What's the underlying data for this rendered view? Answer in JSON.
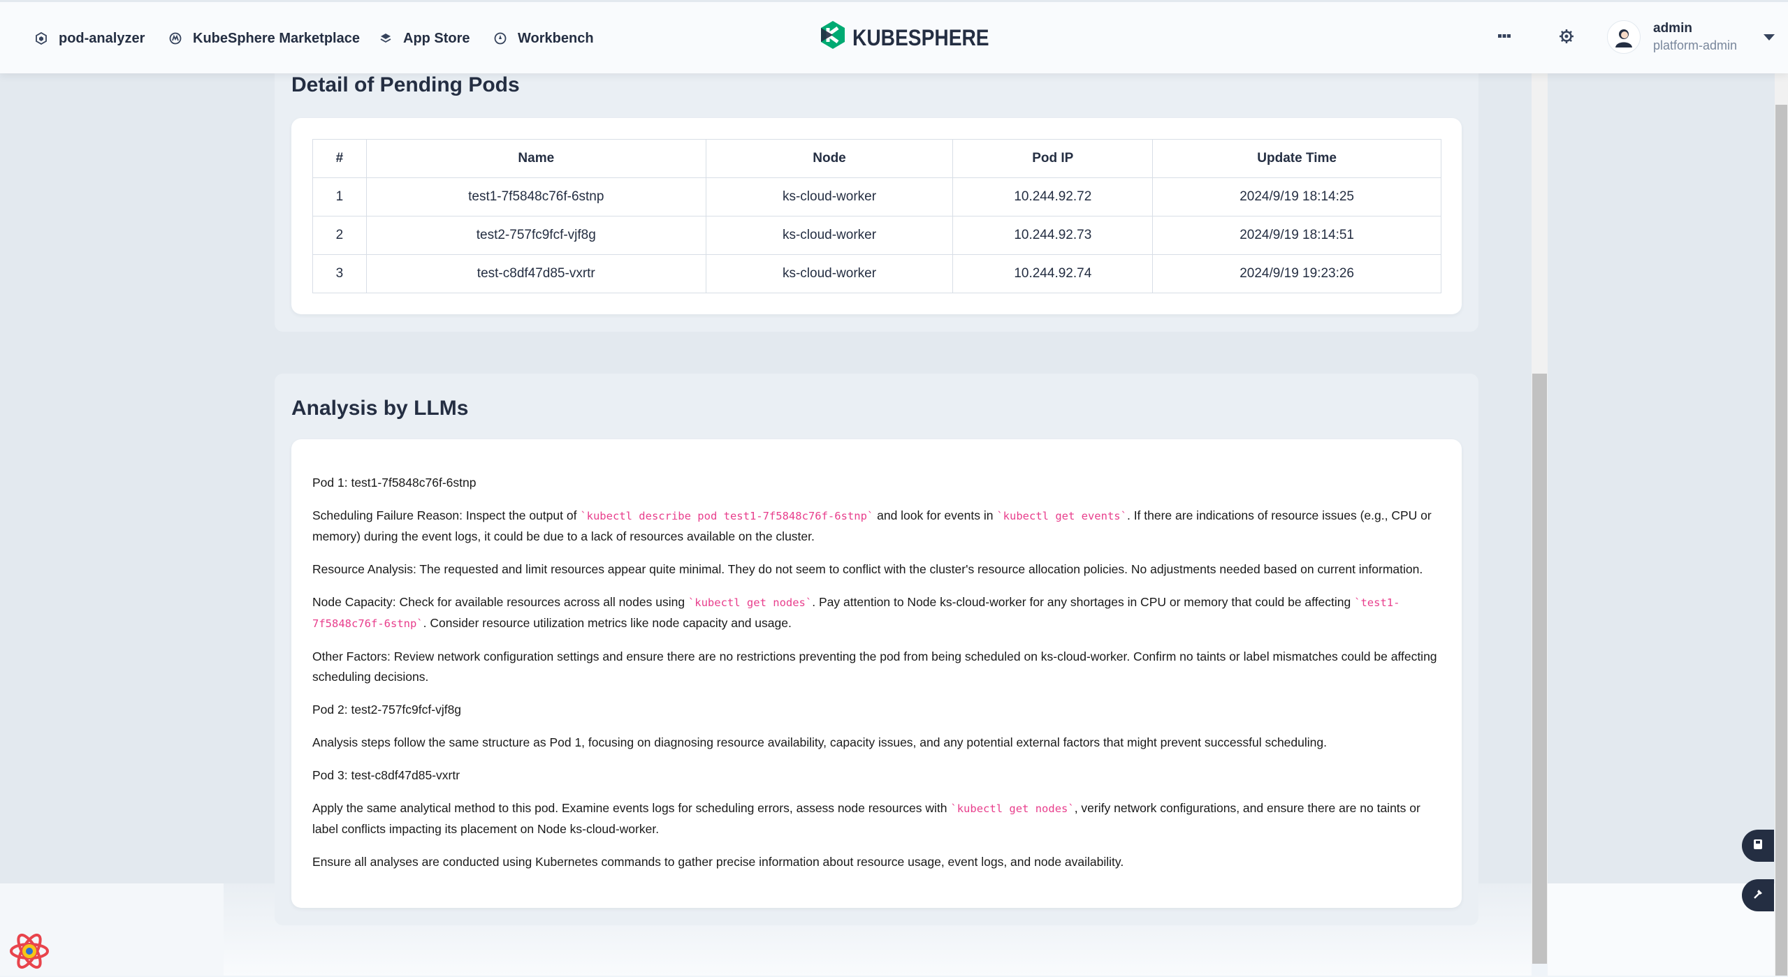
{
  "nav": {
    "items": [
      {
        "label": "pod-analyzer",
        "icon": "cube-icon"
      },
      {
        "label": "KubeSphere Marketplace",
        "icon": "marketplace-icon"
      },
      {
        "label": "App Store",
        "icon": "stack-icon"
      },
      {
        "label": "Workbench",
        "icon": "compass-icon"
      }
    ],
    "logo_text": "KUBESPHERE",
    "user": {
      "name": "admin",
      "role": "platform-admin"
    }
  },
  "pending": {
    "title": "Detail of Pending Pods",
    "columns": [
      "#",
      "Name",
      "Node",
      "Pod IP",
      "Update Time"
    ],
    "rows": [
      [
        "1",
        "test1-7f5848c76f-6stnp",
        "ks-cloud-worker",
        "10.244.92.72",
        "2024/9/19 18:14:25"
      ],
      [
        "2",
        "test2-757fc9fcf-vjf8g",
        "ks-cloud-worker",
        "10.244.92.73",
        "2024/9/19 18:14:51"
      ],
      [
        "3",
        "test-c8df47d85-vxrtr",
        "ks-cloud-worker",
        "10.244.92.74",
        "2024/9/19 19:23:26"
      ]
    ]
  },
  "analysis": {
    "title": "Analysis by LLMs",
    "p1": "Pod 1: test1-7f5848c76f-6stnp",
    "p2a": "Scheduling Failure Reason: Inspect the output of ",
    "p2code1": "`kubectl describe pod test1-7f5848c76f-6stnp`",
    "p2b": " and look for events in ",
    "p2code2": "`kubectl get events`",
    "p2c": ". If there are indications of resource issues (e.g., CPU or memory) during the event logs, it could be due to a lack of resources available on the cluster.",
    "p3": "Resource Analysis: The requested and limit resources appear quite minimal. They do not seem to conflict with the cluster's resource allocation policies. No adjustments needed based on current information.",
    "p4a": "Node Capacity: Check for available resources across all nodes using ",
    "p4code1": "`kubectl get nodes`",
    "p4b": ". Pay attention to Node ks-cloud-worker for any shortages in CPU or memory that could be affecting ",
    "p4code2": "`test1-7f5848c76f-6stnp`",
    "p4c": ". Consider resource utilization metrics like node capacity and usage.",
    "p5": "Other Factors: Review network configuration settings and ensure there are no restrictions preventing the pod from being scheduled on ks-cloud-worker. Confirm no taints or label mismatches could be affecting scheduling decisions.",
    "p6": "Pod 2: test2-757fc9fcf-vjf8g",
    "p7": "Analysis steps follow the same structure as Pod 1, focusing on diagnosing resource availability, capacity issues, and any potential external factors that might prevent successful scheduling.",
    "p8": "Pod 3: test-c8df47d85-vxrtr",
    "p9a": "Apply the same analytical method to this pod. Examine events logs for scheduling errors, assess node resources with ",
    "p9code": "`kubectl get nodes`",
    "p9b": ", verify network configurations, and ensure there are no taints or label conflicts impacting its placement on Node ks-cloud-worker.",
    "p10": "Ensure all analyses are conducted using Kubernetes commands to gather precise information about resource usage, event logs, and node availability."
  },
  "colors": {
    "accent": "#242e42",
    "code": "#e83e8c",
    "logo_green": "#00aa72"
  }
}
